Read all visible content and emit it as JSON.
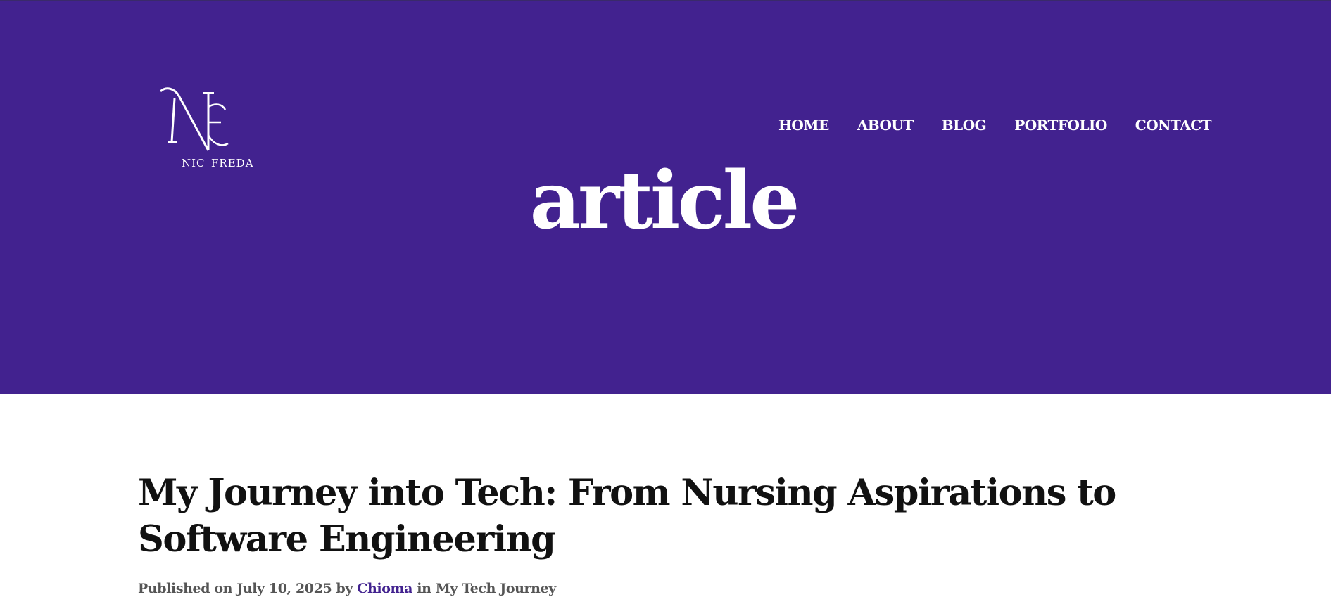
{
  "brand": {
    "logo_caption": "NIC_FREDA",
    "logo_letters": "NF"
  },
  "nav": {
    "items": [
      {
        "label": "HOME"
      },
      {
        "label": "ABOUT"
      },
      {
        "label": "BLOG"
      },
      {
        "label": "PORTFOLIO"
      },
      {
        "label": "CONTACT"
      }
    ]
  },
  "hero": {
    "title": "article",
    "background_color": "#42228f"
  },
  "post": {
    "title": "My Journey into Tech: From Nursing Aspirations to Software Engineering",
    "meta": {
      "published_prefix": "Published on",
      "date": "July 10, 2025",
      "by": "by",
      "author": "Chioma",
      "in": "in",
      "category": "My Tech Journey"
    }
  },
  "colors": {
    "accent": "#42228f",
    "text": "#111111",
    "meta_text": "#555555"
  }
}
